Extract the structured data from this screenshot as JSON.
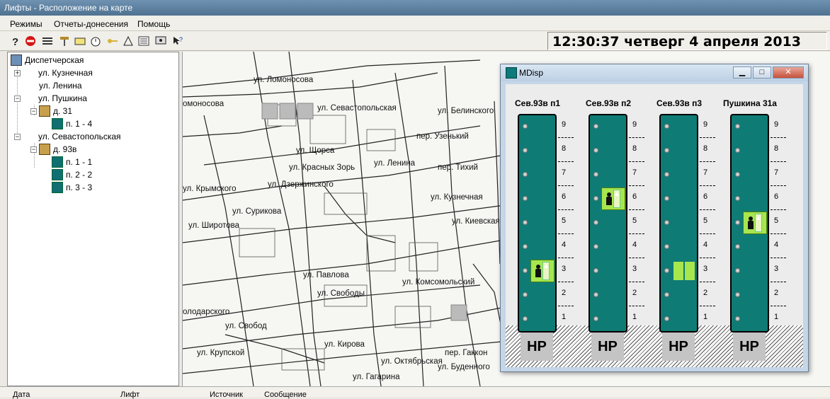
{
  "window": {
    "title": "Лифты - Расположение на карте"
  },
  "menu": [
    {
      "label": "Режимы"
    },
    {
      "label": "Отчеты-донесения"
    },
    {
      "label": "Помощь"
    }
  ],
  "toolbar": {
    "icons": [
      "help-icon",
      "stop-icon",
      "list-icon",
      "key-icon",
      "card-icon",
      "alarm-icon",
      "key2-icon",
      "bell-icon",
      "list2-icon",
      "monitor-icon",
      "whatsthis-icon"
    ]
  },
  "clock": {
    "text": "12:30:37 четверг 4 апреля 2013"
  },
  "tree": {
    "root": "Диспетчерская",
    "streets": [
      {
        "label": "ул. Кузнечная"
      },
      {
        "label": "ул. Ленина"
      },
      {
        "label": "ул. Пушкина"
      },
      {
        "label": "д. 31"
      },
      {
        "label": "п. 1 - 4"
      },
      {
        "label": "ул. Севастопольская"
      },
      {
        "label": "д. 93в"
      },
      {
        "label": "п. 1 - 1"
      },
      {
        "label": "п. 2 - 2"
      },
      {
        "label": "п. 3 - 3"
      }
    ]
  },
  "map": {
    "labels": [
      "ул. Ломоносова",
      "омоносова",
      "ул. Севастопольская",
      "ул. Белинского",
      "пер. Узенький",
      "ул. Ленина",
      "ул. Щорса",
      "ул. Красных Зорь",
      "пер. Тихий",
      "ул. Крымского",
      "ул. Дзержинского",
      "ул. Кузнечная",
      "ул. Киевская",
      "ул. Широтова",
      "ул. Сурикова",
      "ул. Павлова",
      "ул. Свободы",
      "ул. Кирова",
      "ул. Крупской",
      "олодарского",
      "ул. Свобод",
      "ул. Комсомольский",
      "пер. Гаккон",
      "ул. Буденного",
      "ул. Гагарина",
      "ул. Октябрьская"
    ]
  },
  "mdisp": {
    "title": "MDisp",
    "minimize": "▁",
    "maximize": "□",
    "close": "✕",
    "floors": [
      "9",
      "8",
      "7",
      "6",
      "5",
      "4",
      "3",
      "2",
      "1"
    ],
    "shafts": [
      {
        "title": "Сев.93в п1",
        "hp": "HP",
        "cab_floor": 3,
        "state": "occupied-up"
      },
      {
        "title": "Сев.93в п2",
        "hp": "HP",
        "cab_floor": 6,
        "state": "occupied-up"
      },
      {
        "title": "Сев.93в п3",
        "hp": "HP",
        "cab_floor": 3,
        "state": "doors-open"
      },
      {
        "title": "Пушкина 31а",
        "hp": "HP",
        "cab_floor": 5,
        "state": "occupied-up"
      }
    ]
  },
  "status": {
    "columns": [
      "Дата",
      "Лифт",
      "Источник",
      "Сообщение"
    ]
  },
  "colors": {
    "shaft": "#0f7b75",
    "cab": "#a8e64e"
  }
}
